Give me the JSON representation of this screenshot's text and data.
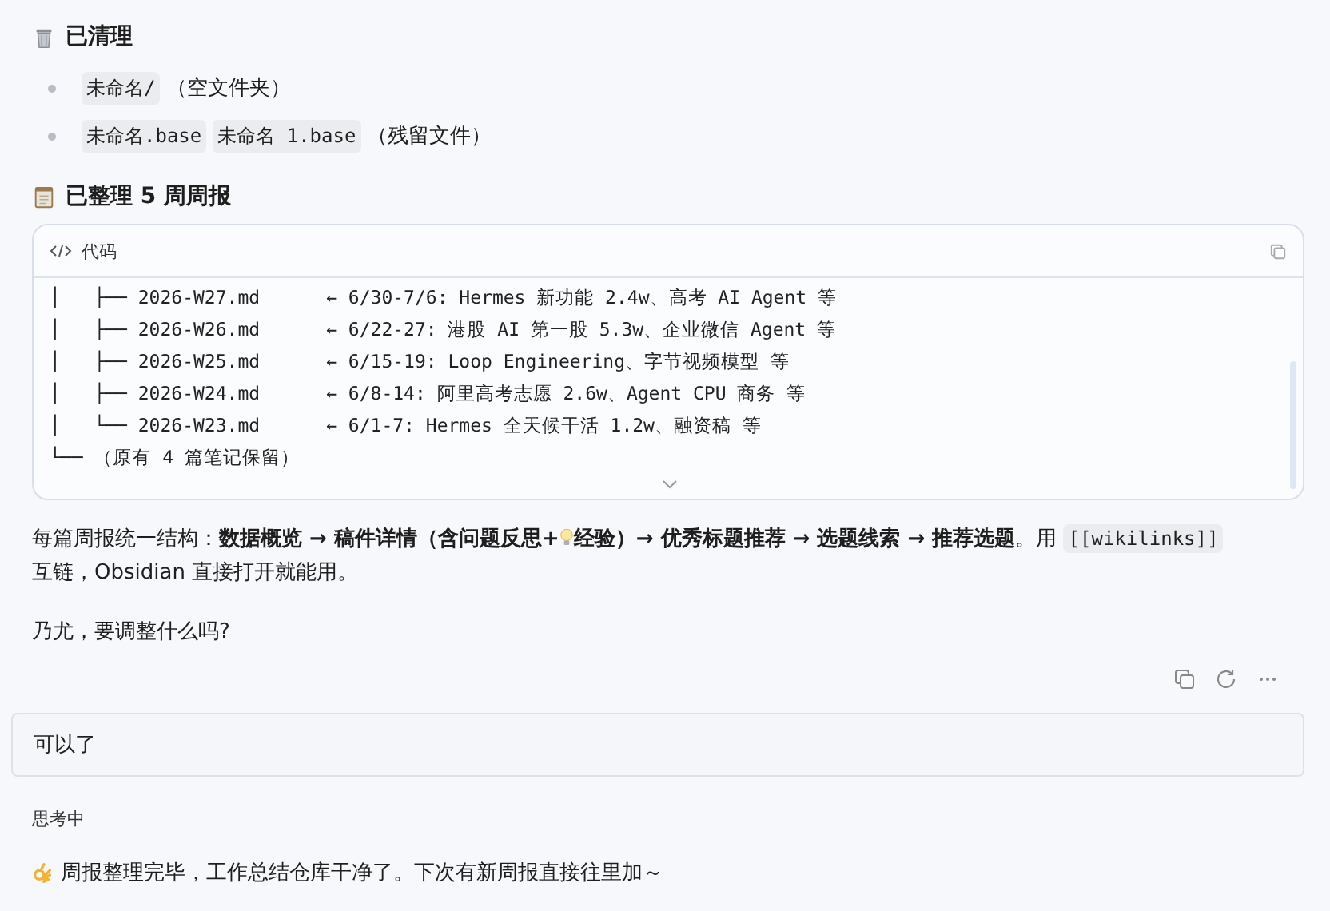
{
  "sections": [
    {
      "title": "已清理",
      "bullets": [
        {
          "chips": [
            "未命名/"
          ],
          "note": "（空文件夹）"
        },
        {
          "chips": [
            "未命名.base",
            "未命名 1.base"
          ],
          "note": "（残留文件）"
        }
      ]
    },
    {
      "title": "已整理 5 周周报"
    }
  ],
  "code_block": {
    "label": "代码",
    "lines": [
      "│   ├── 2026-W27.md      ← 6/30-7/6: Hermes 新功能 2.4w、高考 AI Agent 等",
      "│   ├── 2026-W26.md      ← 6/22-27: 港股 AI 第一股 5.3w、企业微信 Agent 等",
      "│   ├── 2026-W25.md      ← 6/15-19: Loop Engineering、字节视频模型 等",
      "│   ├── 2026-W24.md      ← 6/8-14: 阿里高考志愿 2.6w、Agent CPU 商务 等",
      "│   └── 2026-W23.md      ← 6/1-7: Hermes 全天候干活 1.2w、融资稿 等",
      "└── （原有 4 篇笔记保留）"
    ]
  },
  "summary": {
    "before_icon": "每篇周报统一结构：**数据概览 → 稿件详情（含问题反思+**",
    "after_icon": "**经验）→ 优秀标题推荐 → 选题线索 → 推荐选题**。用 ",
    "code": "[[wikilinks]]",
    "tail": "互链，Obsidian 直接打开就能用。"
  },
  "question": "乃尤，要调整什么吗?",
  "user_message": "可以了",
  "status": "思考中",
  "reply": "周报整理完毕，工作总结仓库干净了。下次有新周报直接往里加～"
}
